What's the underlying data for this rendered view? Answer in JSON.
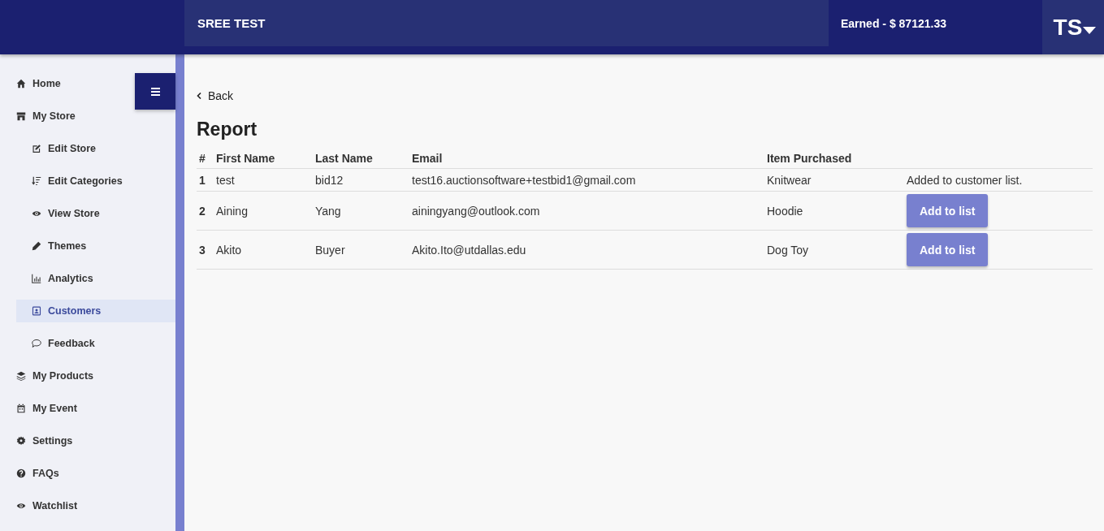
{
  "header": {
    "store_name": "SREE TEST",
    "earned": "Earned - $ 87121.33",
    "avatar_initials": "TS"
  },
  "sidebar": {
    "items": [
      {
        "label": "Home",
        "selected": false
      },
      {
        "label": "My Store",
        "selected": false,
        "children": [
          {
            "label": "Edit Store",
            "selected": false
          },
          {
            "label": "Edit Categories",
            "selected": false
          },
          {
            "label": "View Store",
            "selected": false
          },
          {
            "label": "Themes",
            "selected": false
          },
          {
            "label": "Analytics",
            "selected": false
          },
          {
            "label": "Customers",
            "selected": true
          },
          {
            "label": "Feedback",
            "selected": false
          }
        ]
      },
      {
        "label": "My Products",
        "selected": false
      },
      {
        "label": "My Event",
        "selected": false
      },
      {
        "label": "Settings",
        "selected": false
      },
      {
        "label": "FAQs",
        "selected": false
      },
      {
        "label": "Watchlist",
        "selected": false
      }
    ]
  },
  "back_link": "Back",
  "title": "Report",
  "table": {
    "columns": [
      "#",
      "First Name",
      "Last Name",
      "Email",
      "Item Purchased"
    ],
    "rows": [
      {
        "cells": [
          "1",
          "test",
          "bid12",
          "test16.auctionsoftware+testbid1@gmail.com",
          "Knitwear"
        ],
        "action": {
          "kind": "note",
          "text": "Added to customer list."
        }
      },
      {
        "cells": [
          "2",
          "Aining",
          "Yang",
          "ainingyang@outlook.com",
          "Hoodie"
        ],
        "action": {
          "kind": "button",
          "text": "Add to list"
        }
      },
      {
        "cells": [
          "3",
          "Akito",
          "Buyer",
          "Akito.Ito@utdallas.edu",
          "Dog Toy"
        ],
        "action": {
          "kind": "button",
          "text": "Add to list"
        }
      }
    ]
  }
}
